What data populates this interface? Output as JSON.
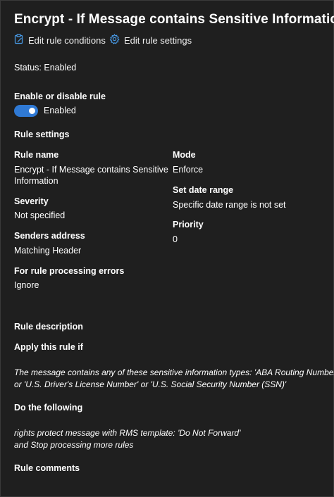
{
  "header": {
    "title": "Encrypt - If Message contains Sensitive Information",
    "edit_conditions_label": "Edit rule conditions",
    "edit_settings_label": "Edit rule settings"
  },
  "status": {
    "text": "Status: Enabled"
  },
  "toggle_section": {
    "heading": "Enable or disable rule",
    "state_label": "Enabled",
    "enabled": true,
    "accent_color": "#2f79d4"
  },
  "rule_settings": {
    "heading": "Rule settings",
    "rule_name_label": "Rule name",
    "rule_name_line1": "Encrypt - If Message contains Sensitive",
    "rule_name_line2": "Information",
    "mode_label": "Mode",
    "mode_value": "Enforce",
    "date_range_label": "Set date range",
    "date_range_value": "Specific date range is not set",
    "severity_label": "Severity",
    "severity_value": "Not specified",
    "priority_label": "Priority",
    "priority_value": "0",
    "senders_label": "Senders address",
    "senders_value": "Matching Header",
    "errors_label": "For rule processing errors",
    "errors_value": "Ignore"
  },
  "description": {
    "heading": "Rule description",
    "apply_label": "Apply this rule if",
    "condition_line1": "The message contains any of these sensitive information types: 'ABA Routing Number'",
    "condition_line2": "or 'U.S. Driver's License Number' or 'U.S. Social Security Number (SSN)'",
    "do_label": "Do the following",
    "action_line1": "rights protect message with RMS template:  'Do Not Forward'",
    "action_line2": "and Stop processing more rules"
  },
  "comments": {
    "heading": "Rule comments"
  },
  "icons": {
    "edit_conditions": "clipboard-edit-icon",
    "edit_settings": "gear-icon"
  }
}
